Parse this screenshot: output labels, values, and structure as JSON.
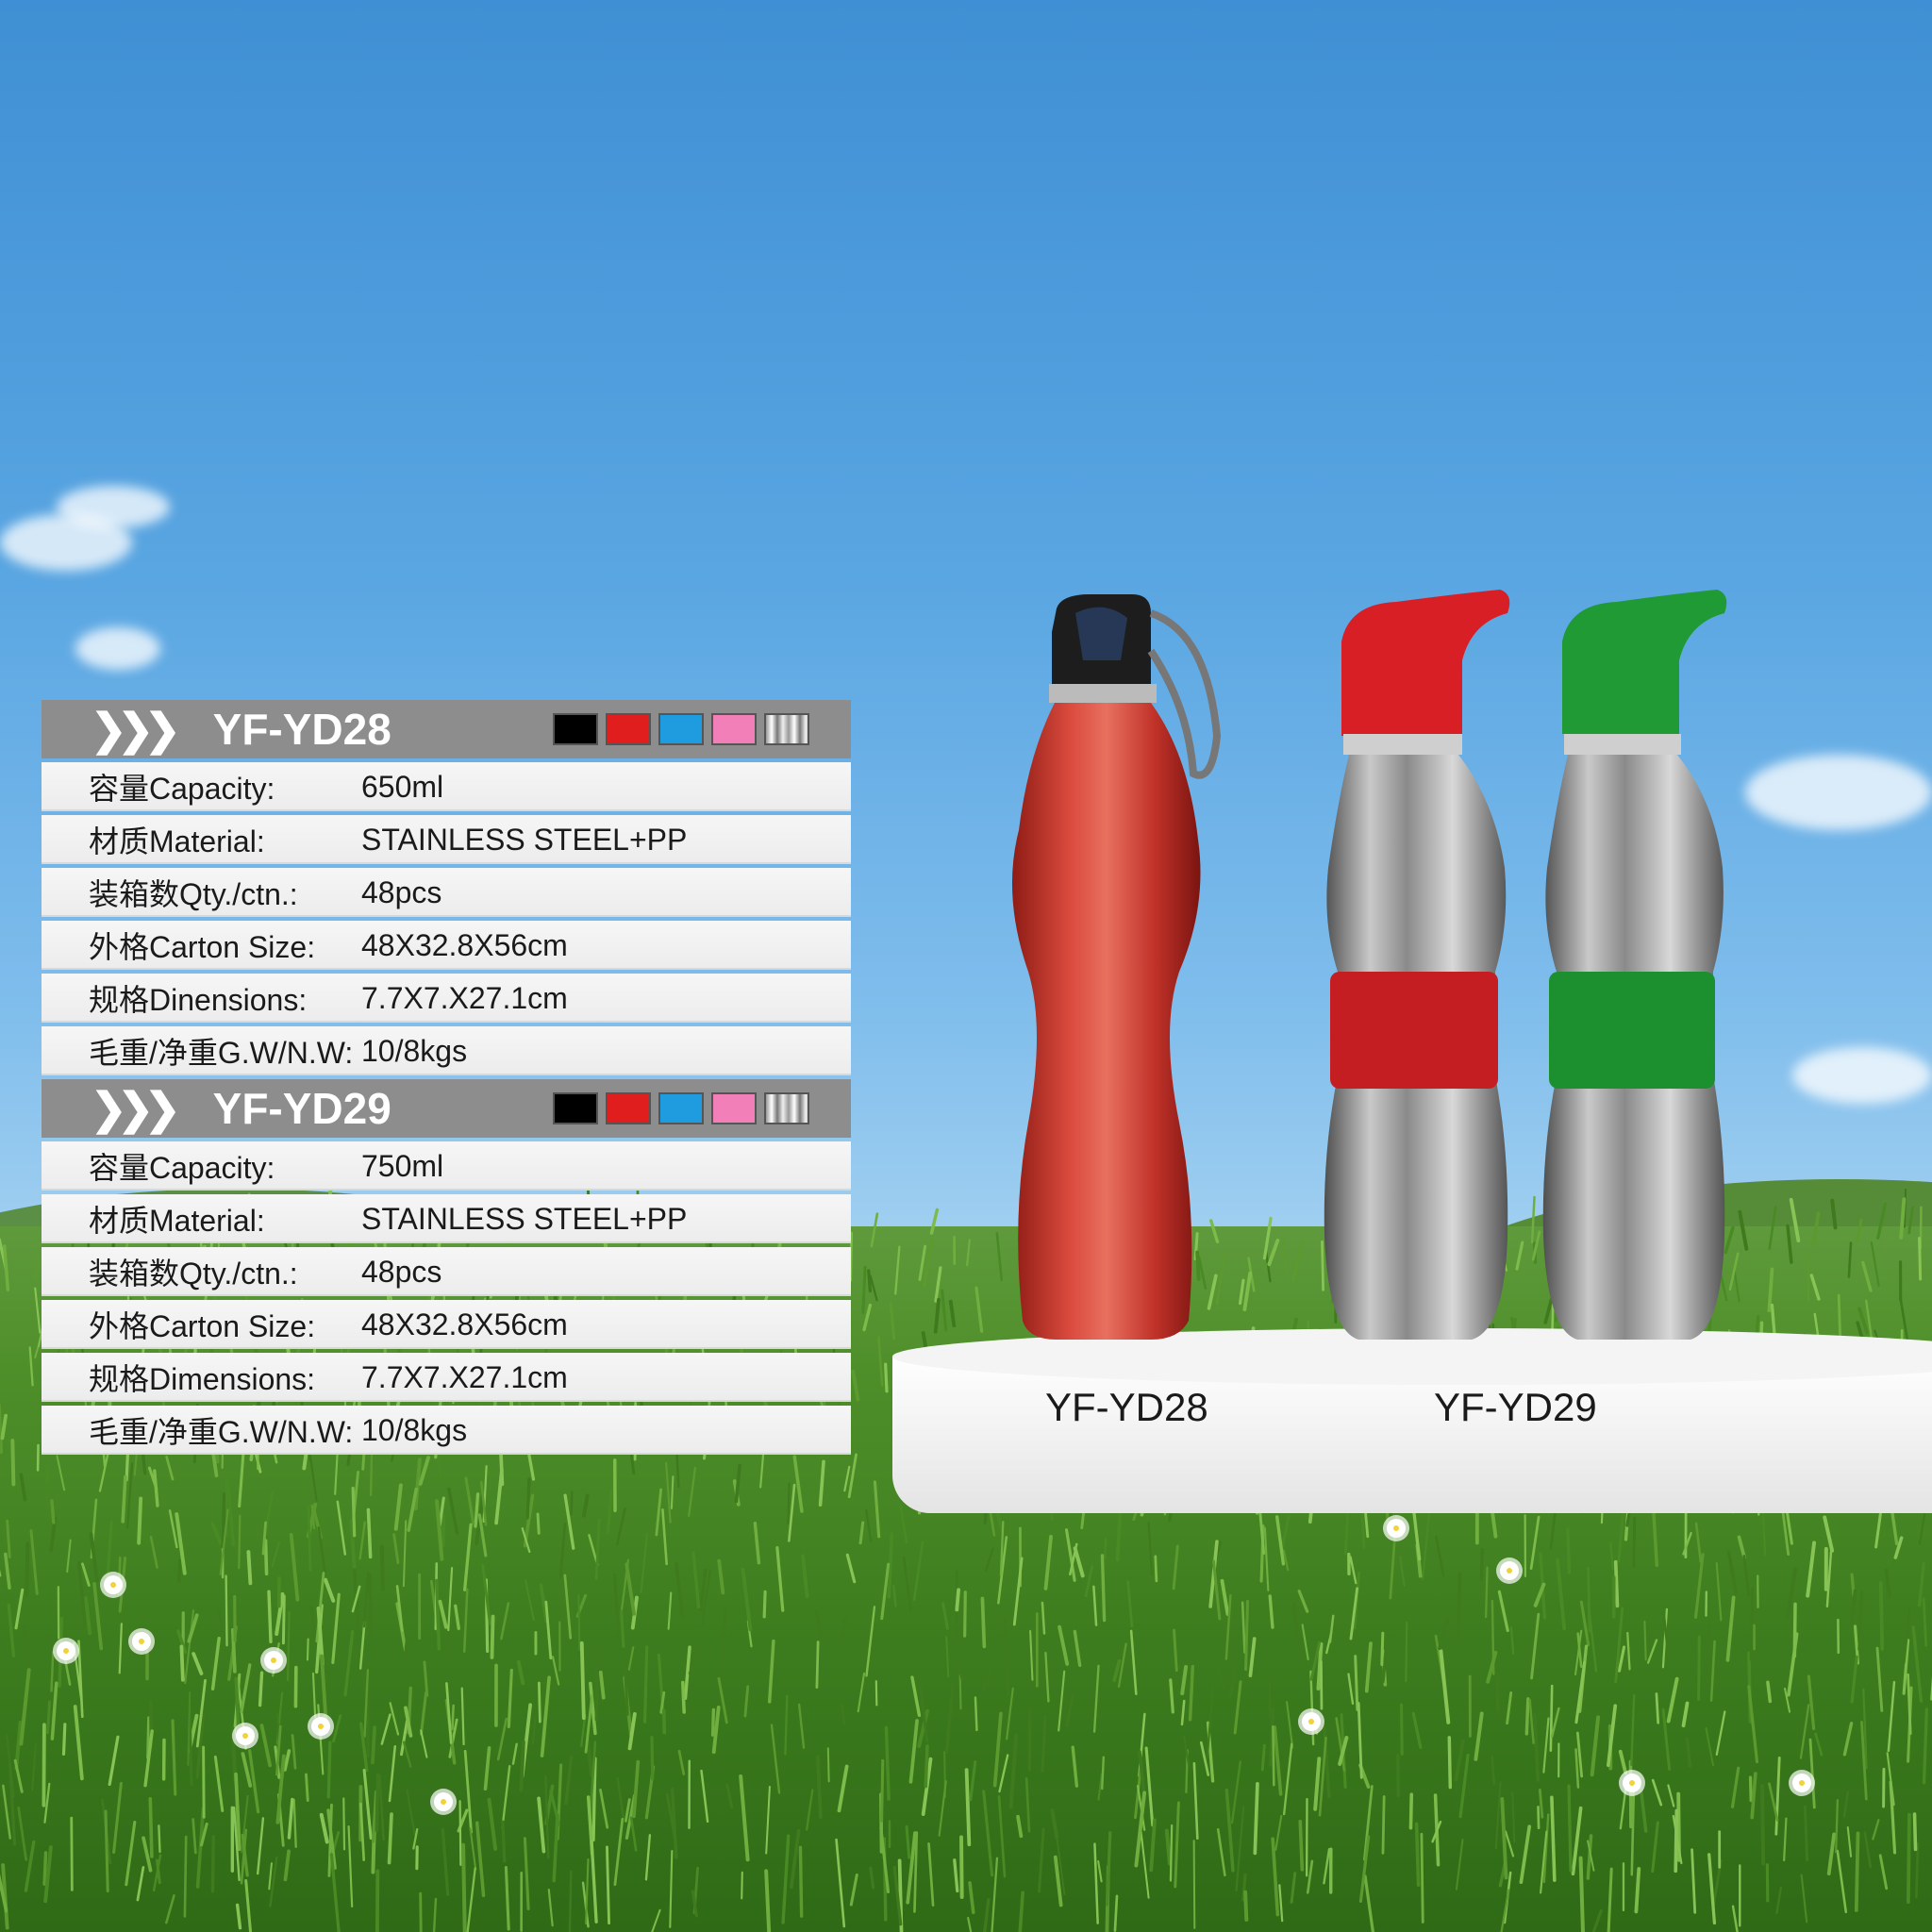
{
  "products": [
    {
      "model": "YF-YD28",
      "swatches": [
        "#000000",
        "#e01e1e",
        "#1f9be0",
        "#f27fb8",
        "stainless"
      ],
      "specs": [
        {
          "label": "容量Capacity:",
          "value": "650ml"
        },
        {
          "label": "材质Material:",
          "value": "STAINLESS STEEL+PP"
        },
        {
          "label": "装箱数Qty./ctn.:",
          "value": "48pcs"
        },
        {
          "label": "外格Carton Size:",
          "value": "48X32.8X56cm"
        },
        {
          "label": "规格Dinensions:",
          "value": "7.7X7.X27.1cm"
        },
        {
          "label": "毛重/净重G.W/N.W:",
          "value": "10/8kgs"
        }
      ]
    },
    {
      "model": "YF-YD29",
      "swatches": [
        "#000000",
        "#e01e1e",
        "#1f9be0",
        "#f27fb8",
        "stainless"
      ],
      "specs": [
        {
          "label": "容量Capacity:",
          "value": "750ml"
        },
        {
          "label": "材质Material:",
          "value": "STAINLESS STEEL+PP"
        },
        {
          "label": "装箱数Qty./ctn.:",
          "value": "48pcs"
        },
        {
          "label": "外格Carton Size:",
          "value": "48X32.8X56cm"
        },
        {
          "label": "规格Dimensions:",
          "value": "7.7X7.X27.1cm"
        },
        {
          "label": "毛重/净重G.W/N.W:",
          "value": "10/8kgs"
        }
      ]
    }
  ],
  "podium_labels": [
    "YF-YD28",
    "YF-YD29"
  ],
  "colors": {
    "header_bar": "#8d8d8d",
    "bottle_red": "#c9332a",
    "cap_red": "#d91f26",
    "cap_green": "#1f9a34",
    "sleeve_red": "#c41d22",
    "sleeve_green": "#1c8f2e"
  },
  "icons": {
    "header_chevrons": "triple-chevron-right-icon"
  }
}
